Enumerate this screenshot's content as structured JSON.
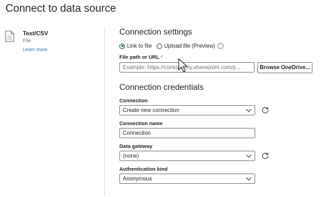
{
  "dialog": {
    "title": "Connect to data source"
  },
  "source": {
    "icon": "file-icon",
    "name": "Text/CSV",
    "type": "File",
    "learn_more": "Learn more"
  },
  "connection_settings": {
    "heading": "Connection settings",
    "radios": [
      {
        "label": "Link to file",
        "selected": true
      },
      {
        "label": "Upload file (Preview)",
        "selected": false
      }
    ],
    "file_path": {
      "label": "File path or URL",
      "required_mark": "*",
      "placeholder": "Example: https://contoso-my.sharepoint.com/p..."
    },
    "browse_button": "Browse OneDrive..."
  },
  "connection_credentials": {
    "heading": "Connection credentials",
    "connection": {
      "label": "Connection",
      "value": "Create new connection"
    },
    "connection_name": {
      "label": "Connection name",
      "value": "Connection"
    },
    "data_gateway": {
      "label": "Data gateway",
      "value": "(none)"
    },
    "auth_kind": {
      "label": "Authentication kind",
      "value": "Anonymous"
    }
  },
  "icons": {
    "refresh": "refresh-icon",
    "chevron": "chevron-down-icon",
    "info": "info-icon",
    "cursor": "mouse-cursor-icon"
  },
  "colors": {
    "accent_green": "#1f6b3a",
    "link_blue": "#2f6fb5",
    "required_red": "#b10e1c"
  }
}
